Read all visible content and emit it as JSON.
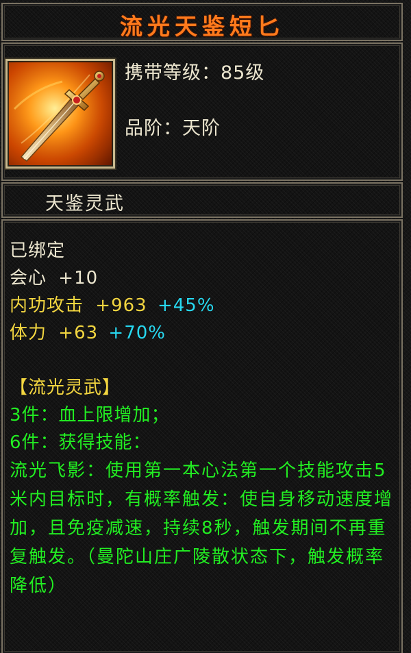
{
  "item": {
    "name": "流光天鉴短匕",
    "icon": "golden-dagger-icon",
    "level_label": "携带等级：85级",
    "grade_label": "品阶：天阶",
    "category": "天鉴灵武",
    "bound": "已绑定"
  },
  "attributes": [
    {
      "name": "会心",
      "value": "+10",
      "bonus": ""
    },
    {
      "name": "内功攻击",
      "value": "+963",
      "bonus": "+45%"
    },
    {
      "name": "体力",
      "value": "+63",
      "bonus": "+70%"
    }
  ],
  "set": {
    "title": "【流光灵武】",
    "bonus3": "3件：血上限增加；",
    "bonus6": "6件：获得技能：",
    "skill_desc": "流光飞影：使用第一本心法第一个技能攻击5米内目标时，有概率触发：使自身移动速度增加，且免疫减速，持续8秒，触发期间不再重复触发。（曼陀山庄广陵散状态下，触发概率降低）"
  },
  "colors": {
    "title": "#ff7a1c",
    "text": "#ece6cf",
    "attr": "#f3d640",
    "bonus": "#27d8f0",
    "set": "#22ee22"
  }
}
